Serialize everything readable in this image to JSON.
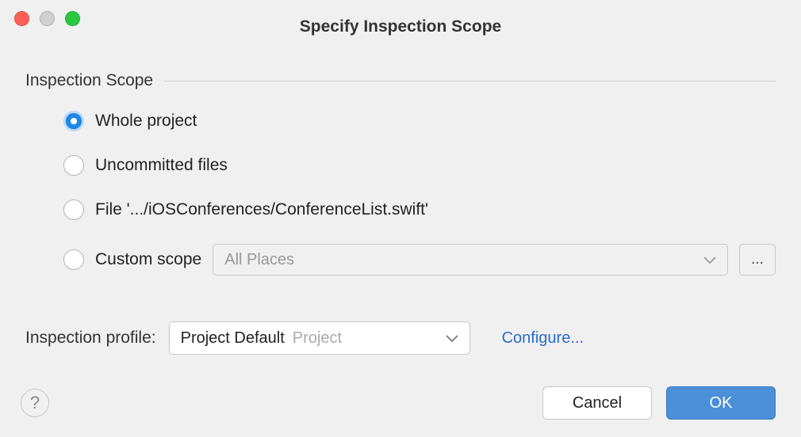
{
  "window": {
    "title": "Specify Inspection Scope"
  },
  "section": {
    "label": "Inspection Scope"
  },
  "radios": {
    "whole_project": "Whole project",
    "uncommitted": "Uncommitted files",
    "file": "File '.../iOSConferences/ConferenceList.swift'",
    "custom": "Custom scope"
  },
  "custom_scope_dropdown": {
    "value": "All Places"
  },
  "ellipsis": "...",
  "profile": {
    "label": "Inspection profile:",
    "value_main": "Project Default",
    "value_sub": "Project"
  },
  "configure": "Configure...",
  "help": "?",
  "buttons": {
    "cancel": "Cancel",
    "ok": "OK"
  }
}
